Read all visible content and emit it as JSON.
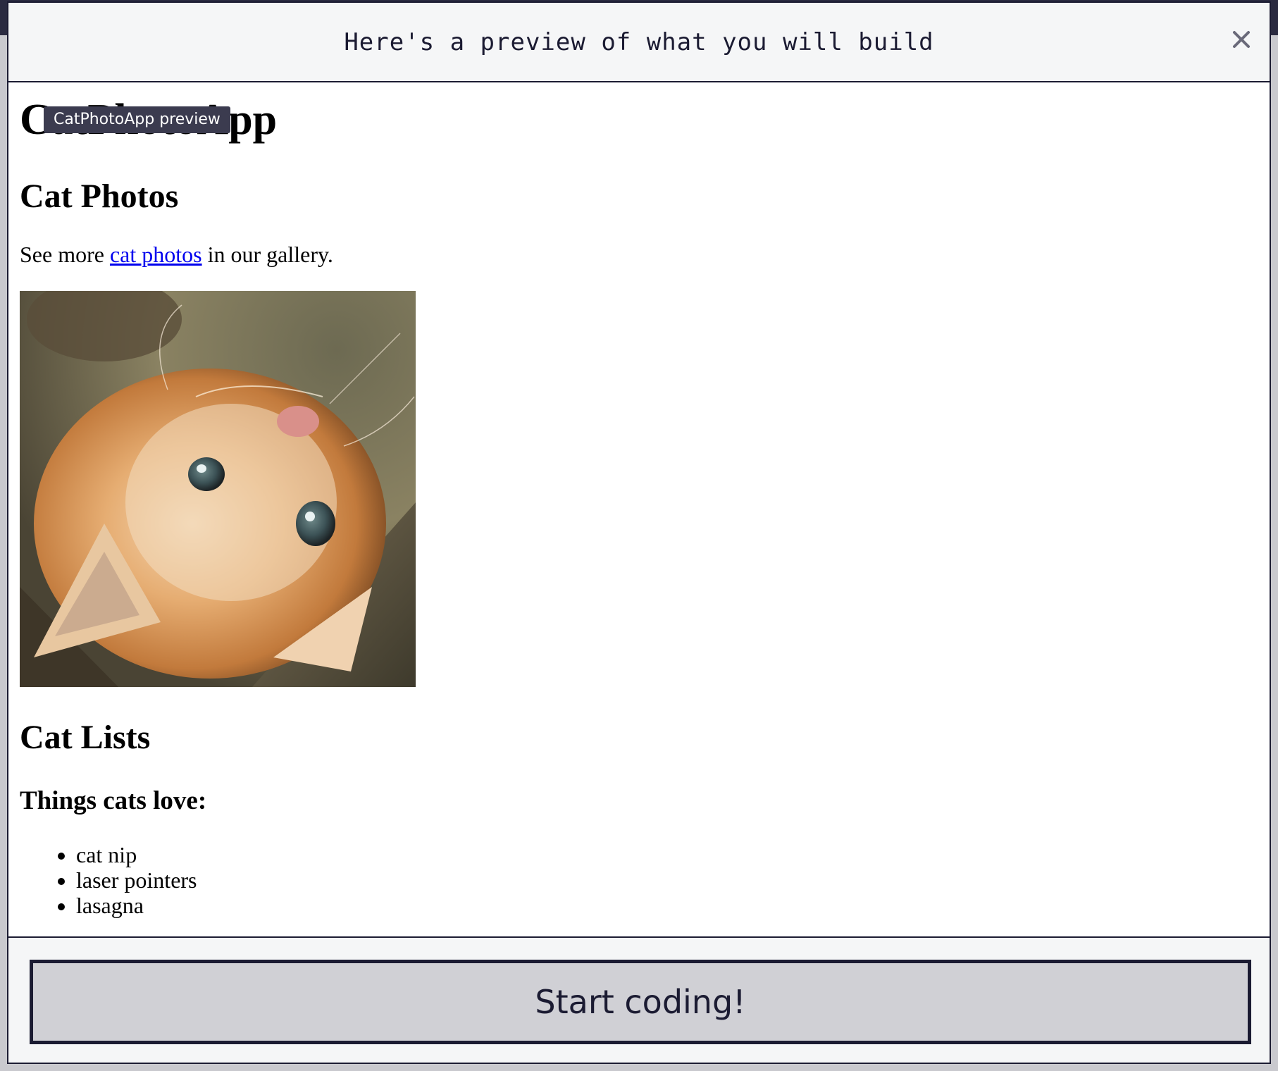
{
  "modal": {
    "title": "Here's a preview of what you will build",
    "close_icon": "close-icon",
    "footer": {
      "start_label": "Start coding!"
    }
  },
  "preview": {
    "tooltip": "CatPhotoApp preview",
    "app_title": "CatPhotoApp",
    "photos_heading": "Cat Photos",
    "gallery_text_before": "See more ",
    "gallery_link": "cat photos",
    "gallery_text_after": " in our gallery.",
    "lists_heading": "Cat Lists",
    "things_heading": "Things cats love:",
    "love_items": [
      "cat nip",
      "laser pointers",
      "lasagna"
    ]
  },
  "colors": {
    "accent_dark": "#1b1b32",
    "header_bg": "#f5f6f7",
    "button_bg": "#d0d0d5",
    "link": "#0000ee"
  }
}
